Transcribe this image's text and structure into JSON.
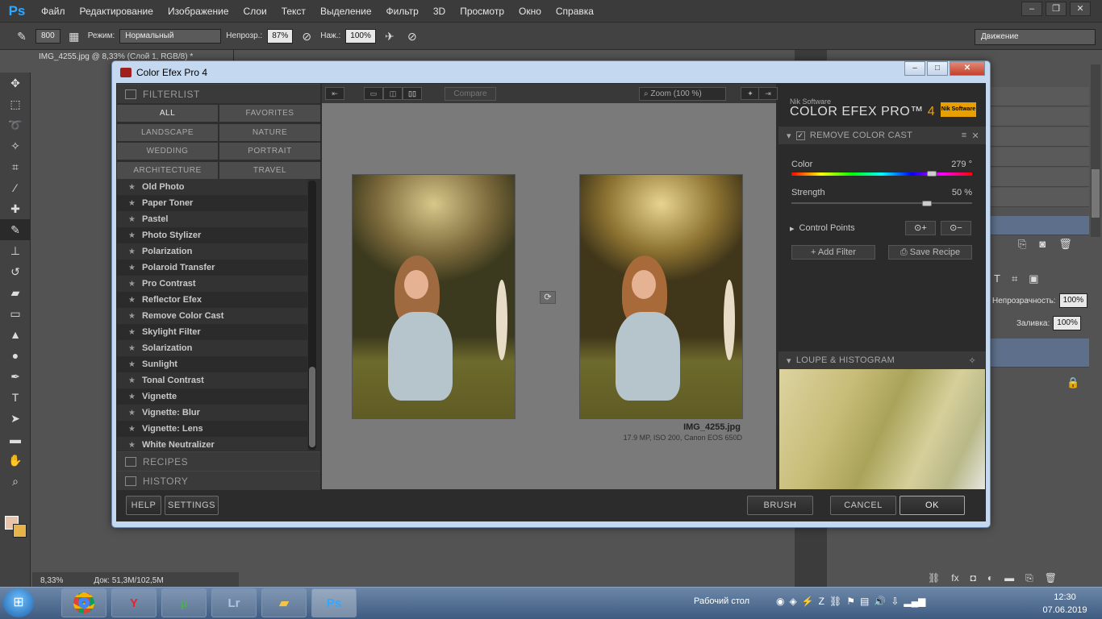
{
  "photoshop": {
    "logo": "Ps",
    "menu": [
      "Файл",
      "Редактирование",
      "Изображение",
      "Слои",
      "Текст",
      "Выделение",
      "Фильтр",
      "3D",
      "Просмотр",
      "Окно",
      "Справка"
    ],
    "options": {
      "brush_size": "800",
      "mode_label": "Режим:",
      "mode_value": "Нормальный",
      "opacity_label": "Непрозр.:",
      "opacity_value": "87%",
      "pressure_label": "Наж.:",
      "pressure_value": "100%"
    },
    "workspace": "Движение",
    "doc_tab": "IMG_4255.jpg @ 8,33% (Слой 1, RGB/8) *",
    "status_zoom": "8,33%",
    "status_doc": "Док: 51,3M/102,5M",
    "layers": {
      "opacity_label": "Непрозрачность:",
      "opacity_value": "100%",
      "fill_label": "Заливка:",
      "fill_value": "100%"
    }
  },
  "dialog": {
    "title": "Color Efex Pro 4",
    "filterlist_label": "FILTERLIST",
    "categories": [
      "ALL",
      "FAVORITES",
      "LANDSCAPE",
      "NATURE",
      "WEDDING",
      "PORTRAIT",
      "ARCHITECTURE",
      "TRAVEL"
    ],
    "filters": [
      "Old Photo",
      "Paper Toner",
      "Pastel",
      "Photo Stylizer",
      "Polarization",
      "Polaroid Transfer",
      "Pro Contrast",
      "Reflector Efex",
      "Remove Color Cast",
      "Skylight Filter",
      "Solarization",
      "Sunlight",
      "Tonal Contrast",
      "Vignette",
      "Vignette: Blur",
      "Vignette: Lens",
      "White Neutralizer"
    ],
    "recipes_label": "RECIPES",
    "history_label": "HISTORY",
    "compare_label": "Compare",
    "zoom_label": "Zoom (100 %)",
    "image_name": "IMG_4255.jpg",
    "image_meta": "17.9 MP, ISO 200, Canon EOS 650D",
    "brand_small": "Nik Software",
    "brand_main": "COLOR EFEX PRO™",
    "brand_version": "4",
    "nik_logo": "Nik Software",
    "active_filter": "REMOVE COLOR CAST",
    "color_label": "Color",
    "color_value": "279 °",
    "color_level": 279,
    "strength_label": "Strength",
    "strength_value": "50 %",
    "strength_level": 50,
    "control_points_label": "Control Points",
    "add_filter_label": "Add Filter",
    "save_recipe_label": "Save Recipe",
    "loupe_label": "LOUPE & HISTOGRAM",
    "help_label": "HELP",
    "settings_label": "SETTINGS",
    "brush_label": "BRUSH",
    "cancel_label": "CANCEL",
    "ok_label": "OK"
  },
  "taskbar": {
    "apps": [
      "chrome",
      "yandex",
      "utorrent",
      "Lr",
      "explorer",
      "Ps"
    ],
    "desktop_label": "Рабочий стол",
    "time": "12:30",
    "date": "07.06.2019"
  },
  "colors": {
    "ps_accent": "#31a8ff",
    "nik_orange": "#e8a000",
    "dialog_bg": "#2c2c2c"
  }
}
